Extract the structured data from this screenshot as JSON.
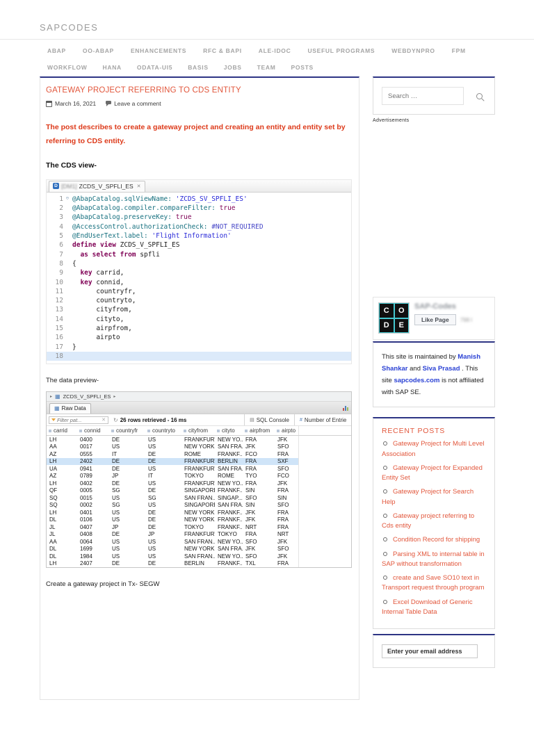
{
  "header": {
    "logo": "SAPCODES"
  },
  "nav": {
    "row1": [
      "ABAP",
      "OO-ABAP",
      "ENHANCEMENTS",
      "RFC & BAPI",
      "ALE-IDOC",
      "USEFUL PROGRAMS",
      "WEBDYNPRO",
      "FPM"
    ],
    "row2": [
      "WORKFLOW",
      "HANA",
      "ODATA-UI5",
      "BASIS",
      "JOBS",
      "TEAM",
      "POSTS"
    ]
  },
  "post": {
    "title": "GATEWAY PROJECT REFERRING TO CDS ENTITY",
    "date": "March 16, 2021",
    "comments_label": "Leave a comment",
    "intro": "The post describes to create a gateway project and creating an entity and entity set by referring to CDS entity.",
    "cds_heading": "The CDS view-",
    "data_preview_heading": "The data preview-",
    "closing_text": "Create a gateway project in Tx- SEGW"
  },
  "editor": {
    "tab": {
      "icon_letter": "D",
      "system_id": "[DM1]",
      "name": "ZCDS_V_SPFLI_ES",
      "close_icon": "✕"
    },
    "fold_icon": "⊖",
    "lines": [
      {
        "n": "1",
        "fold": true,
        "seg": [
          [
            "ann",
            "@AbapCatalog.sqlViewName:"
          ],
          [
            "str",
            " 'ZCDS_SV_SPFLI_ES'"
          ]
        ]
      },
      {
        "n": "2",
        "seg": [
          [
            "ann",
            "@AbapCatalog.compiler.compareFilter:"
          ],
          [
            "kw",
            " true"
          ]
        ]
      },
      {
        "n": "3",
        "seg": [
          [
            "ann",
            "@AbapCatalog.preserveKey:"
          ],
          [
            "kw",
            " true"
          ]
        ]
      },
      {
        "n": "4",
        "seg": [
          [
            "ann",
            "@AccessControl.authorizationCheck:"
          ],
          [
            "enm",
            " #NOT_REQUIRED"
          ]
        ]
      },
      {
        "n": "5",
        "seg": [
          [
            "ann",
            "@EndUserText.label:"
          ],
          [
            "str",
            " 'Flight Information'"
          ]
        ]
      },
      {
        "n": "6",
        "seg": [
          [
            "kwb",
            "define view"
          ],
          [
            "pln",
            " ZCDS_V_SPFLI_ES"
          ]
        ]
      },
      {
        "n": "7",
        "seg": [
          [
            "pln",
            "  "
          ],
          [
            "kwb",
            "as select from"
          ],
          [
            "pln",
            " spfli"
          ]
        ]
      },
      {
        "n": "8",
        "seg": [
          [
            "pln",
            "{"
          ]
        ]
      },
      {
        "n": "9",
        "seg": [
          [
            "pln",
            "  "
          ],
          [
            "kwb",
            "key"
          ],
          [
            "pln",
            " carrid,"
          ]
        ]
      },
      {
        "n": "10",
        "seg": [
          [
            "pln",
            "  "
          ],
          [
            "kwb",
            "key"
          ],
          [
            "pln",
            " connid,"
          ]
        ]
      },
      {
        "n": "11",
        "seg": [
          [
            "pln",
            "      countryfr,"
          ]
        ]
      },
      {
        "n": "12",
        "seg": [
          [
            "pln",
            "      countryto,"
          ]
        ]
      },
      {
        "n": "13",
        "seg": [
          [
            "pln",
            "      cityfrom,"
          ]
        ]
      },
      {
        "n": "14",
        "seg": [
          [
            "pln",
            "      cityto,"
          ]
        ]
      },
      {
        "n": "15",
        "seg": [
          [
            "pln",
            "      airpfrom,"
          ]
        ]
      },
      {
        "n": "16",
        "seg": [
          [
            "pln",
            "      airpto"
          ]
        ]
      },
      {
        "n": "17",
        "seg": [
          [
            "pln",
            "}"
          ]
        ]
      },
      {
        "n": "18",
        "hl": true,
        "seg": []
      }
    ]
  },
  "data_preview": {
    "breadcrumb": {
      "arrow": "▸",
      "icon": "▦",
      "name": "ZCDS_V_SPFLI_ES"
    },
    "tab": {
      "icon": "▦",
      "label": "Raw Data"
    },
    "toolbar": {
      "filter_placeholder": "Filter pat...",
      "clear_icon": "✕",
      "refresh_icon": "↻",
      "status": "26 rows retrieved - 16 ms",
      "sql_console_icon": "▤",
      "sql_console": "SQL Console",
      "entries_icon": "#",
      "entries_label": "Number of Entrie"
    },
    "columns": [
      "carrid",
      "connid",
      "countryfr",
      "countryto",
      "cityfrom",
      "cityto",
      "airpfrom",
      "airpto"
    ],
    "selected_row_index": 3,
    "rows": [
      [
        "LH",
        "0400",
        "DE",
        "US",
        "FRANKFURT",
        "NEW YO...",
        "FRA",
        "JFK"
      ],
      [
        "AA",
        "0017",
        "US",
        "US",
        "NEW YORK",
        "SAN FRA...",
        "JFK",
        "SFO"
      ],
      [
        "AZ",
        "0555",
        "IT",
        "DE",
        "ROME",
        "FRANKF...",
        "FCO",
        "FRA"
      ],
      [
        "LH",
        "2402",
        "DE",
        "DE",
        "FRANKFURT",
        "BERLIN",
        "FRA",
        "SXF"
      ],
      [
        "UA",
        "0941",
        "DE",
        "US",
        "FRANKFURT",
        "SAN FRA...",
        "FRA",
        "SFO"
      ],
      [
        "AZ",
        "0789",
        "JP",
        "IT",
        "TOKYO",
        "ROME",
        "TYO",
        "FCO"
      ],
      [
        "LH",
        "0402",
        "DE",
        "US",
        "FRANKFURT",
        "NEW YO...",
        "FRA",
        "JFK"
      ],
      [
        "QF",
        "0005",
        "SG",
        "DE",
        "SINGAPORE",
        "FRANKF...",
        "SIN",
        "FRA"
      ],
      [
        "SQ",
        "0015",
        "US",
        "SG",
        "SAN FRAN...",
        "SINGAP...",
        "SFO",
        "SIN"
      ],
      [
        "SQ",
        "0002",
        "SG",
        "US",
        "SINGAPORE",
        "SAN FRA...",
        "SIN",
        "SFO"
      ],
      [
        "LH",
        "0401",
        "US",
        "DE",
        "NEW YORK",
        "FRANKF...",
        "JFK",
        "FRA"
      ],
      [
        "DL",
        "0106",
        "US",
        "DE",
        "NEW YORK",
        "FRANKF...",
        "JFK",
        "FRA"
      ],
      [
        "JL",
        "0407",
        "JP",
        "DE",
        "TOKYO",
        "FRANKF...",
        "NRT",
        "FRA"
      ],
      [
        "JL",
        "0408",
        "DE",
        "JP",
        "FRANKFURT",
        "TOKYO",
        "FRA",
        "NRT"
      ],
      [
        "AA",
        "0064",
        "US",
        "US",
        "SAN FRAN...",
        "NEW YO...",
        "SFO",
        "JFK"
      ],
      [
        "DL",
        "1699",
        "US",
        "US",
        "NEW YORK",
        "SAN FRA...",
        "JFK",
        "SFO"
      ],
      [
        "DL",
        "1984",
        "US",
        "US",
        "SAN FRAN...",
        "NEW YO...",
        "SFO",
        "JFK"
      ],
      [
        "LH",
        "2407",
        "DE",
        "DE",
        "BERLIN",
        "FRANKF...",
        "TXL",
        "FRA"
      ]
    ]
  },
  "sidebar": {
    "search_placeholder": "Search …",
    "ads_label": "Advertisements",
    "facebook": {
      "avatar_letters": [
        "C",
        "O",
        "D",
        "E"
      ],
      "page_name": "SAP-Codes",
      "like_button": "Like Page",
      "likes": "798 l"
    },
    "maintained_parts": [
      {
        "t": "This site is maintained by ",
        "link": false
      },
      {
        "t": "Manish Shankar",
        "link": true
      },
      {
        "t": " and ",
        "link": false
      },
      {
        "t": "Siva Prasad",
        "link": true
      },
      {
        "t": " . This site ",
        "link": false
      },
      {
        "t": "sapcodes.com",
        "link": true
      },
      {
        "t": " is not affiliated with SAP SE.",
        "link": false
      }
    ],
    "recent": {
      "heading": "RECENT POSTS",
      "items": [
        "Gateway Project for Multi Level Association",
        "Gateway Project for Expanded Entity Set",
        "Gateway Project for Search Help",
        "Gateway project referring to Cds entity",
        "Condition Record for shipping",
        "Parsing XML to internal table in SAP without transformation",
        "create and Save SO10 text in Transport request through program",
        "Excel Download of Generic Internal Table Data"
      ]
    },
    "subscribe_value": "Enter your email address"
  },
  "colors": {
    "navy_border": "#2d3484",
    "accent_red": "#e2573c",
    "intro_red": "#dd3a1a",
    "link_blue": "#2a41d4",
    "selected_row": "#cfe4f8"
  }
}
